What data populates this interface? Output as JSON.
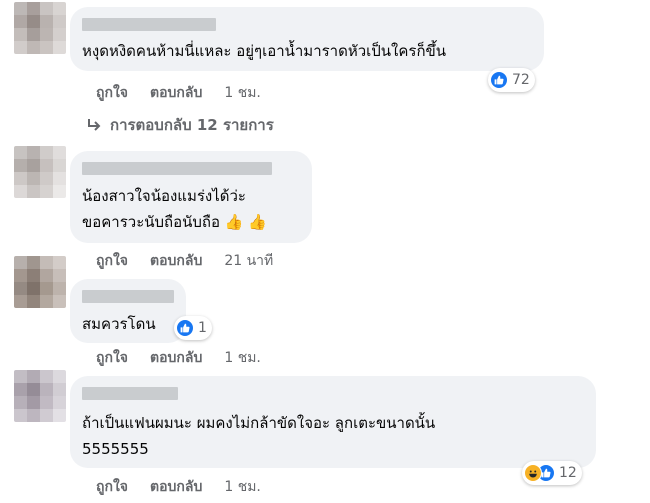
{
  "actions": {
    "like": "ถูกใจ",
    "reply": "ตอบกลับ"
  },
  "comments": [
    {
      "text_lines": [
        "หงุดหงิดคนห้ามนี่แหละ อยู่ๆเอาน้ำมาราดหัวเป็นใครก็ขึ้น"
      ],
      "time": "1 ชม.",
      "reaction_icons": [
        "like-icon"
      ],
      "reaction_count": "72",
      "replies_label": "การตอบกลับ 12 รายการ"
    },
    {
      "text_lines": [
        "น้องสาวใจน้องแมร่งได้ว่ะ",
        "ขอคารวะนับถือนับถือ"
      ],
      "emoji": "👍 👍",
      "time": "21 นาที"
    },
    {
      "text_lines": [
        "สมควรโดน"
      ],
      "time": "1 ชม.",
      "reaction_icons": [
        "like-icon"
      ],
      "reaction_count": "1"
    },
    {
      "text_lines": [
        "ถ้าเป็นแฟนผมนะ ผมคงไม่กล้าขัดใจอะ ลูกเตะขนาดนั้น",
        "5555555"
      ],
      "time": "1 ชม.",
      "reaction_icons": [
        "haha-icon",
        "like-icon"
      ],
      "reaction_count": "12"
    }
  ],
  "colors": {
    "bubble": "#f0f2f5",
    "meta": "#65676b",
    "like": "#1877f2",
    "haha": "#f7b125"
  }
}
